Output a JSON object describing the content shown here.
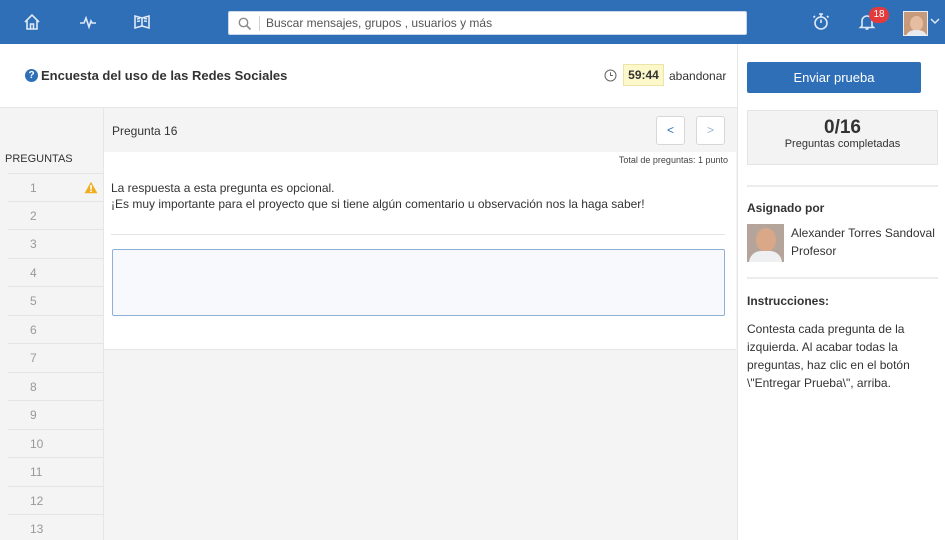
{
  "nav": {
    "icons": [
      "home-icon",
      "activity-icon",
      "book-icon"
    ],
    "search_placeholder": "Buscar mensajes, grupos , usuarios y más",
    "notifications_count": "18",
    "brand_color": "#2f6fb8"
  },
  "quiz": {
    "title": "Encuesta del uso de las Redes Sociales",
    "timer": "59:44",
    "quit_label": "abandonar",
    "submit_label": "Enviar prueba"
  },
  "sidebar": {
    "title": "PREGUNTAS",
    "items": [
      {
        "label": "1",
        "warning": true
      },
      {
        "label": "2"
      },
      {
        "label": "3"
      },
      {
        "label": "4"
      },
      {
        "label": "5"
      },
      {
        "label": "6"
      },
      {
        "label": "7"
      },
      {
        "label": "8"
      },
      {
        "label": "9"
      },
      {
        "label": "10"
      },
      {
        "label": "11"
      },
      {
        "label": "12"
      },
      {
        "label": "13"
      }
    ]
  },
  "question": {
    "number_label": "Pregunta 16",
    "prev_label": "<",
    "next_label": ">",
    "points_label": "Total de preguntas: 1 punto",
    "line1": "La respuesta a esta pregunta es opcional.",
    "line2": "¡Es muy importante para el proyecto que si tiene algún comentario u observación nos la haga saber!",
    "answer_value": ""
  },
  "progress": {
    "count": "0/16",
    "label": "Preguntas completadas"
  },
  "assigned": {
    "title": "Asignado por",
    "name": "Alexander Torres Sandoval",
    "role": "Profesor"
  },
  "instructions": {
    "title": "Instrucciones:",
    "text": "Contesta cada pregunta de la izquierda. Al acabar todas la preguntas, haz clic en el botón \\\"Entregar Prueba\\\", arriba."
  }
}
